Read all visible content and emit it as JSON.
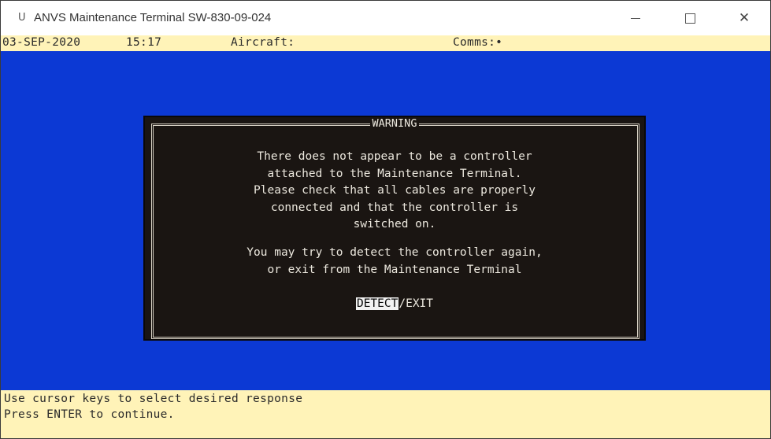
{
  "window": {
    "title": "ANVS Maintenance Terminal SW-830-09-024",
    "app_icon": "U",
    "buttons": {
      "minimize": "minimize-icon",
      "maximize": "maximize-icon",
      "close": "✕"
    }
  },
  "status_bar": {
    "date": "03-SEP-2020",
    "time": "15:17",
    "aircraft_label": "Aircraft:",
    "comms_label": "Comms:•"
  },
  "dialog": {
    "title": "WARNING",
    "message_lines": [
      "There does not appear to be a controller",
      "attached to the Maintenance Terminal.",
      "Please check that all cables are properly",
      "connected and that the controller is",
      "switched on."
    ],
    "message2_lines": [
      "You may try to detect the controller again,",
      "or exit from the Maintenance Terminal"
    ],
    "choices": {
      "detect": "DETECT",
      "separator": "/",
      "exit": "EXIT"
    }
  },
  "help_bar": {
    "line1": "Use cursor keys to select desired response",
    "line2": "Press ENTER to continue."
  },
  "colors": {
    "terminal_blue": "#0c39d4",
    "dialog_background": "#1a1512",
    "status_bar_yellow": "#fff3b8",
    "highlight": "#f2f2f2"
  }
}
